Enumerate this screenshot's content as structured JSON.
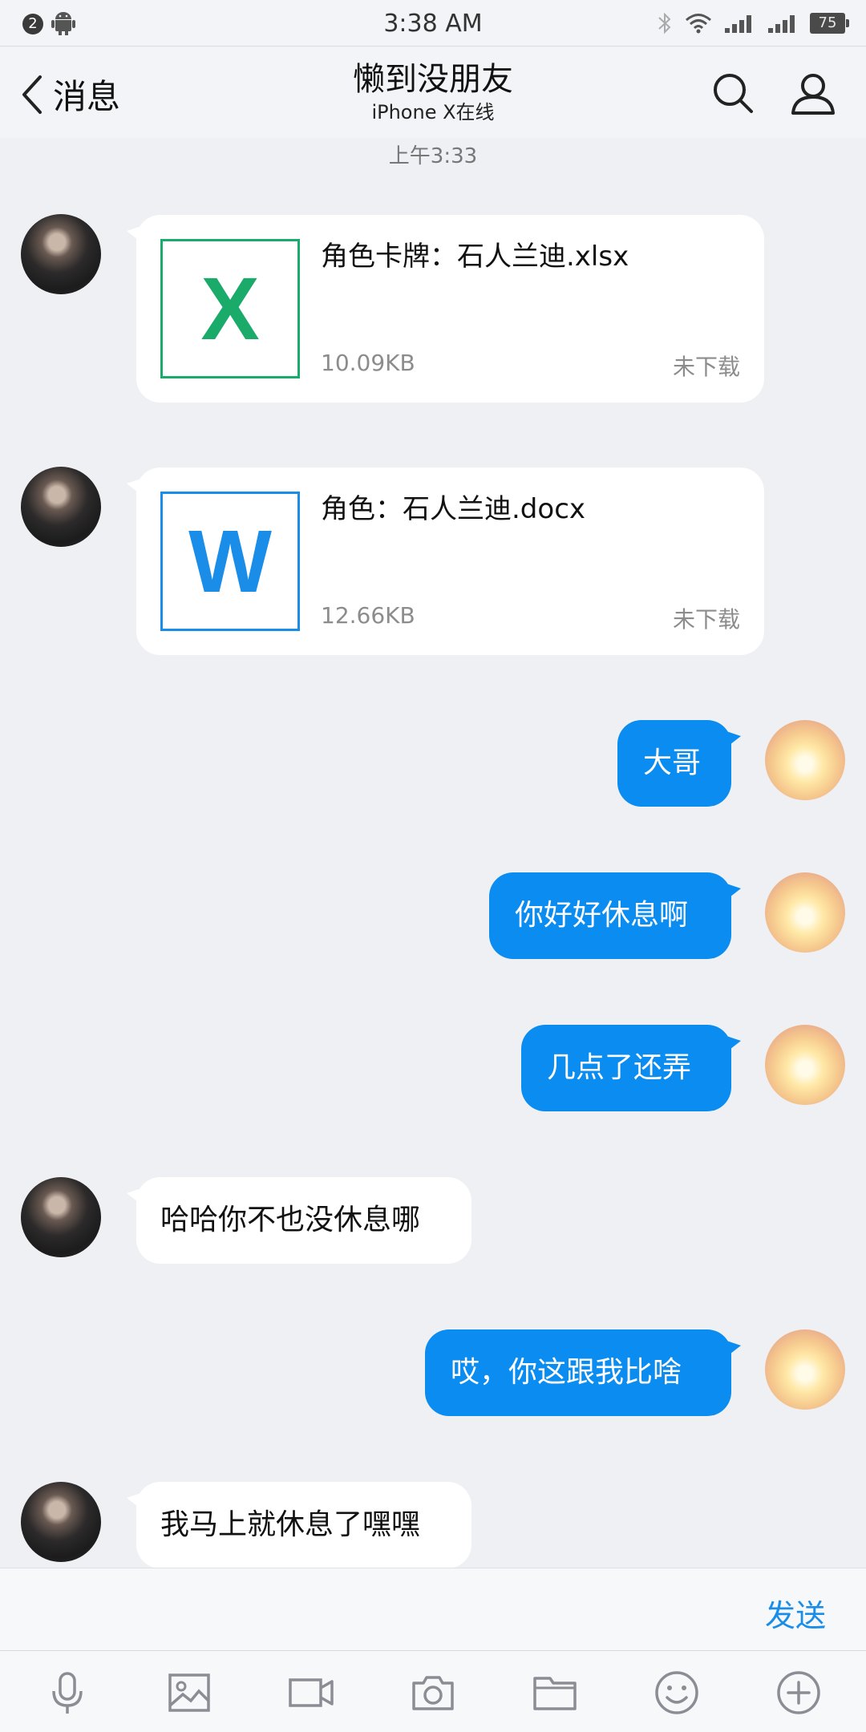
{
  "status_bar": {
    "notification_count": "2",
    "time": "3:38 AM",
    "battery": "75"
  },
  "header": {
    "back_label": "消息",
    "title": "懒到没朋友",
    "subtitle": "iPhone X在线"
  },
  "timestamp": "上午3:33",
  "files": [
    {
      "name": "角色卡牌：石人兰迪.xlsx",
      "size": "10.09KB",
      "status": "未下载",
      "icon_letter": "X",
      "color": "#1aaa6a"
    },
    {
      "name": "角色：石人兰迪.docx",
      "size": "12.66KB",
      "status": "未下载",
      "icon_letter": "W",
      "color": "#1a8de8"
    }
  ],
  "messages": [
    {
      "side": "out",
      "text": "大哥"
    },
    {
      "side": "out",
      "text": "你好好休息啊"
    },
    {
      "side": "out",
      "text": "几点了还弄"
    },
    {
      "side": "in",
      "text": "哈哈你不也没休息哪"
    },
    {
      "side": "out",
      "text": "哎，你这跟我比啥"
    },
    {
      "side": "in",
      "text": "我马上就休息了嘿嘿"
    }
  ],
  "input": {
    "send_label": "发送"
  },
  "toolbar": [
    "microphone-icon",
    "image-icon",
    "video-icon",
    "camera-icon",
    "folder-icon",
    "emoji-icon",
    "plus-icon"
  ],
  "colors": {
    "outgoing_bubble": "#0a8cf0",
    "accent": "#1a8de8",
    "background": "#eef0f4"
  }
}
